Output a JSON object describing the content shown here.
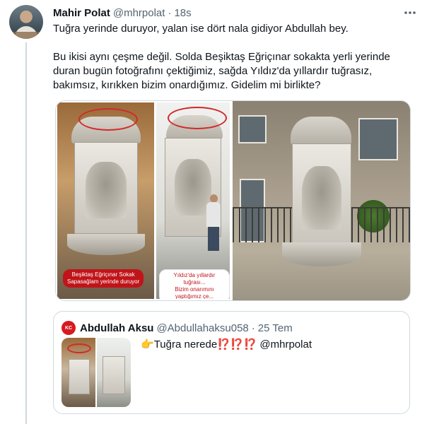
{
  "author": {
    "name": "Mahir Polat",
    "handle": "@mhrpolat",
    "separator": "·",
    "time": "18s"
  },
  "more_icon": "more-horizontal-icon",
  "tweet": {
    "paragraph1": "Tuğra yerinde duruyor, yalan ise dört nala gidiyor Abdullah bey.",
    "paragraph2": "Bu ikisi aynı çeşme değil. Solda Beşiktaş Eğriçınar sokakta yerli yerinde duran bugün fotoğrafını çektiğimiz, sağda Yıldız'da yıllardır tuğrasız, bakımsız, kırıkken bizim onardığımız. Gidelim mi birlikte?"
  },
  "media": {
    "left_caption": "Beşiktaş Eğriçınar Sokak\nSapasağlam yerinde duruyor",
    "right_caption": "Yıldız'da yıllardır tuğrası...\nBizim onarımını yaptığımız çe..."
  },
  "quote": {
    "avatar_text": "KC",
    "name": "Abdullah Aksu",
    "handle": "@Abdullahaksu058",
    "separator": "·",
    "time": "25 Tem",
    "emoji_point": "👉",
    "text": "Tuğra nerede",
    "interrobangs": "⁉️⁉️⁉️",
    "mention": "@mhrpolat"
  },
  "colors": {
    "text_primary": "#0f1419",
    "text_secondary": "#536471",
    "border": "#cfd9de",
    "highlight_red": "#d12a2a",
    "interrobang_red": "#e0245e"
  }
}
